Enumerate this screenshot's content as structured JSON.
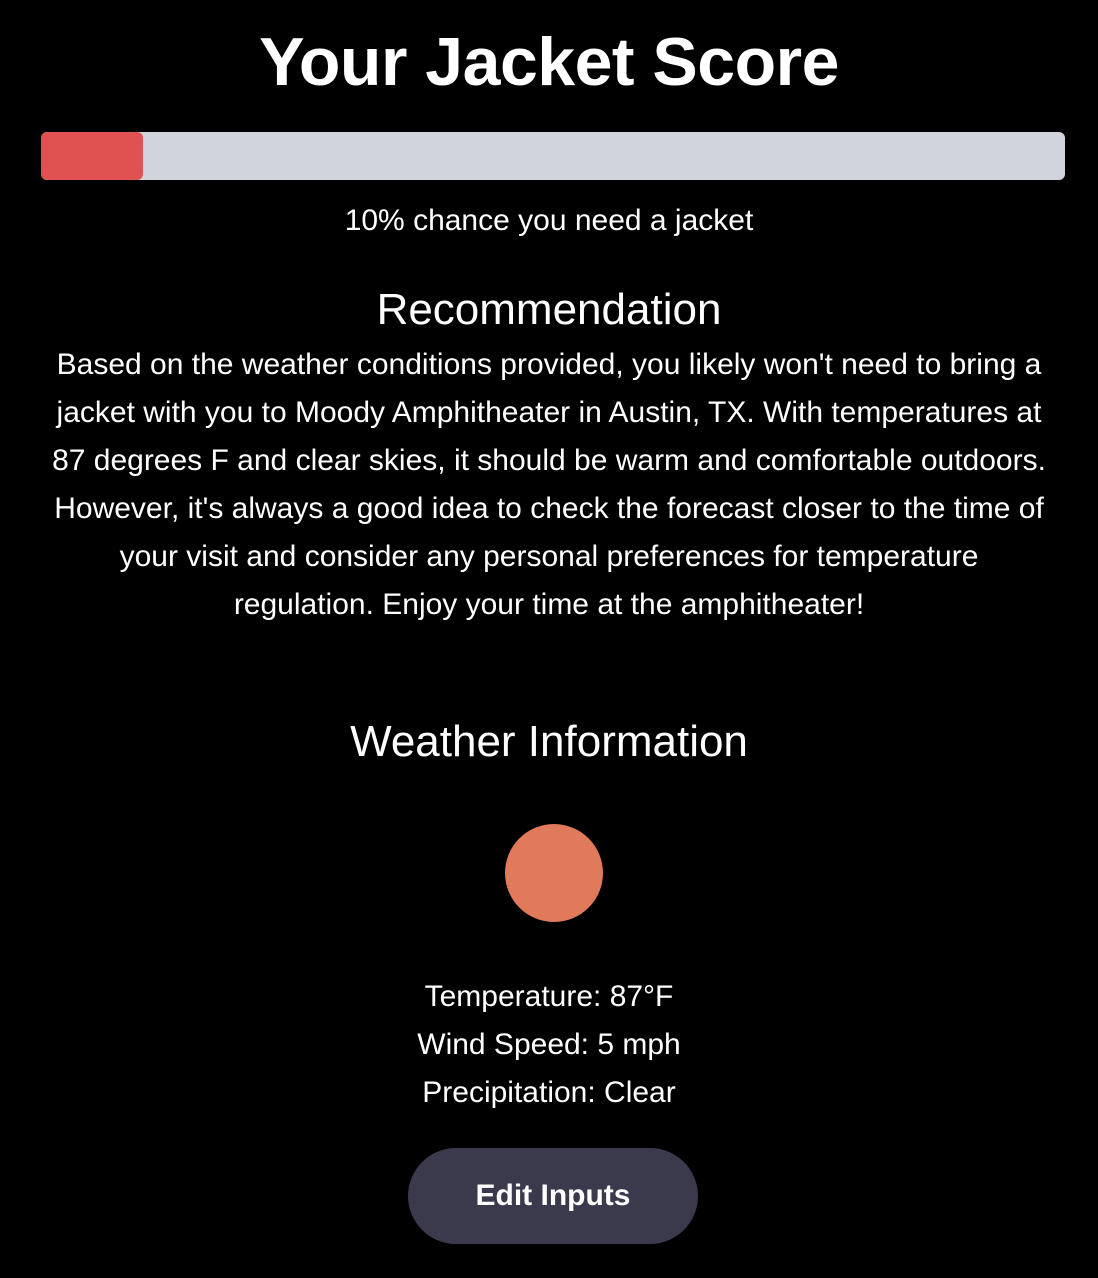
{
  "header": {
    "title": "Your Jacket Score"
  },
  "score": {
    "fraction": 0.1,
    "fill_color": "#e05252",
    "track_color": "#d1d5db",
    "caption": "10% chance you need a jacket"
  },
  "recommendation": {
    "heading": "Recommendation",
    "body": "Based on the weather conditions provided, you likely won't need to bring a jacket with you to Moody Amphitheater in Austin, TX. With temperatures at 87 degrees F and clear skies, it should be warm and comfortable outdoors. However, it's always a good idea to check the forecast closer to the time of your visit and consider any personal preferences for temperature regulation. Enjoy your time at the amphitheater!"
  },
  "weather": {
    "heading": "Weather Information",
    "icon": "sun-icon",
    "icon_color": "#e07a5a",
    "temperature": "Temperature: 87°F",
    "wind_speed": "Wind Speed: 5 mph",
    "precipitation": "Precipitation: Clear"
  },
  "actions": {
    "edit_label": "Edit Inputs",
    "button_color": "#3a3a4c"
  }
}
